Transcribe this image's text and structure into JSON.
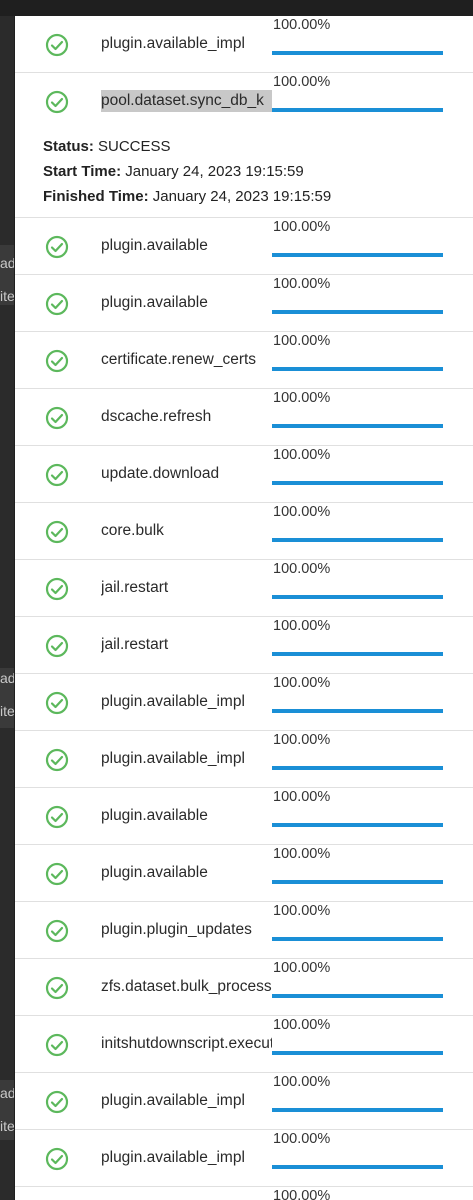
{
  "background": {
    "fragments": [
      "ad",
      "ite",
      "ad",
      "ite",
      "ad",
      "ite"
    ]
  },
  "jobs": [
    {
      "name": "plugin.available_impl",
      "percent": "100.00%",
      "progress": 1.0
    },
    {
      "name": "pool.dataset.sync_db_k",
      "percent": "100.00%",
      "progress": 1.0,
      "selected": true,
      "details": {
        "status_label": "Status:",
        "status": "SUCCESS",
        "start_label": "Start Time:",
        "start": "January 24, 2023 19:15:59",
        "finished_label": "Finished Time:",
        "finished": "January 24, 2023 19:15:59"
      }
    },
    {
      "name": "plugin.available",
      "percent": "100.00%",
      "progress": 1.0
    },
    {
      "name": "plugin.available",
      "percent": "100.00%",
      "progress": 1.0
    },
    {
      "name": "certificate.renew_certs",
      "percent": "100.00%",
      "progress": 1.0
    },
    {
      "name": "dscache.refresh",
      "percent": "100.00%",
      "progress": 1.0
    },
    {
      "name": "update.download",
      "percent": "100.00%",
      "progress": 1.0
    },
    {
      "name": "core.bulk",
      "percent": "100.00%",
      "progress": 1.0
    },
    {
      "name": "jail.restart",
      "percent": "100.00%",
      "progress": 1.0
    },
    {
      "name": "jail.restart",
      "percent": "100.00%",
      "progress": 1.0
    },
    {
      "name": "plugin.available_impl",
      "percent": "100.00%",
      "progress": 1.0
    },
    {
      "name": "plugin.available_impl",
      "percent": "100.00%",
      "progress": 1.0
    },
    {
      "name": "plugin.available",
      "percent": "100.00%",
      "progress": 1.0
    },
    {
      "name": "plugin.available",
      "percent": "100.00%",
      "progress": 1.0
    },
    {
      "name": "plugin.plugin_updates",
      "percent": "100.00%",
      "progress": 1.0
    },
    {
      "name": "zfs.dataset.bulk_process",
      "percent": "100.00%",
      "progress": 1.0
    },
    {
      "name": "initshutdownscript.execute",
      "percent": "100.00%",
      "progress": 1.0
    },
    {
      "name": "plugin.available_impl",
      "percent": "100.00%",
      "progress": 1.0
    },
    {
      "name": "plugin.available_impl",
      "percent": "100.00%",
      "progress": 1.0
    },
    {
      "name": "",
      "percent": "100.00%",
      "progress": 1.0
    }
  ],
  "colors": {
    "check": "#5cb85c",
    "progress": "#1a8fd6",
    "accent": "#1a8fd6"
  },
  "icons": {
    "status": "check-circle-icon"
  }
}
